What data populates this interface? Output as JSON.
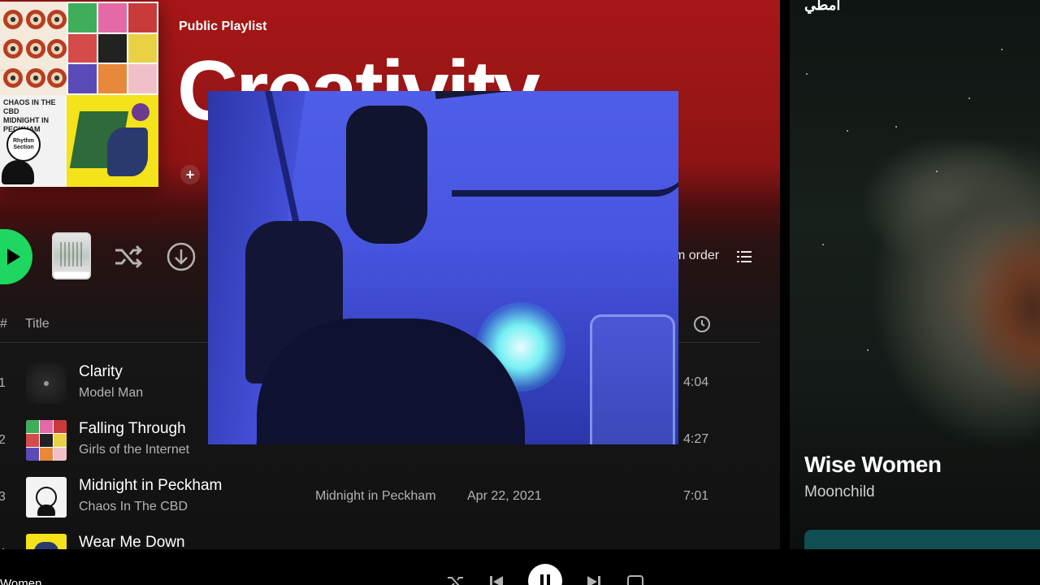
{
  "playlist": {
    "type_label": "Public Playlist",
    "title": "Creativity",
    "add_label": "+"
  },
  "cover_art": {
    "tile_c_tag": "CHAOS IN THE CBD\nMIDNIGHT IN PECKHAM",
    "tile_c_badge": "Rhythm Section"
  },
  "actions": {
    "sort_label": "m order"
  },
  "columns": {
    "hash": "#",
    "title": "Title"
  },
  "tracks": [
    {
      "num": "1",
      "name": "Clarity",
      "artist": "Model Man",
      "album": "",
      "added": "",
      "duration": "4:04"
    },
    {
      "num": "2",
      "name": "Falling Through",
      "artist": "Girls of the Internet",
      "album": "",
      "added": "",
      "duration": "4:27"
    },
    {
      "num": "3",
      "name": "Midnight in Peckham",
      "artist": "Chaos In The CBD",
      "album": "Midnight in Peckham",
      "added": "Apr 22, 2021",
      "duration": "7:01"
    },
    {
      "num": "4",
      "name": "Wear Me Down",
      "artist": "",
      "album": "",
      "added": "",
      "duration": ""
    }
  ],
  "right_panel": {
    "header": "امطي",
    "track_title": "Wise Women",
    "track_artist": "Moonchild"
  },
  "player": {
    "now_playing_short": "Women"
  },
  "colors": {
    "brand_green": "#1ed760",
    "header_red": "#a81717",
    "background": "#121212"
  },
  "icons": [
    "play-icon",
    "shuffle-icon",
    "download-icon",
    "list-icon",
    "clock-icon",
    "skip-back-icon",
    "pause-icon",
    "skip-forward-icon",
    "repeat-icon"
  ]
}
